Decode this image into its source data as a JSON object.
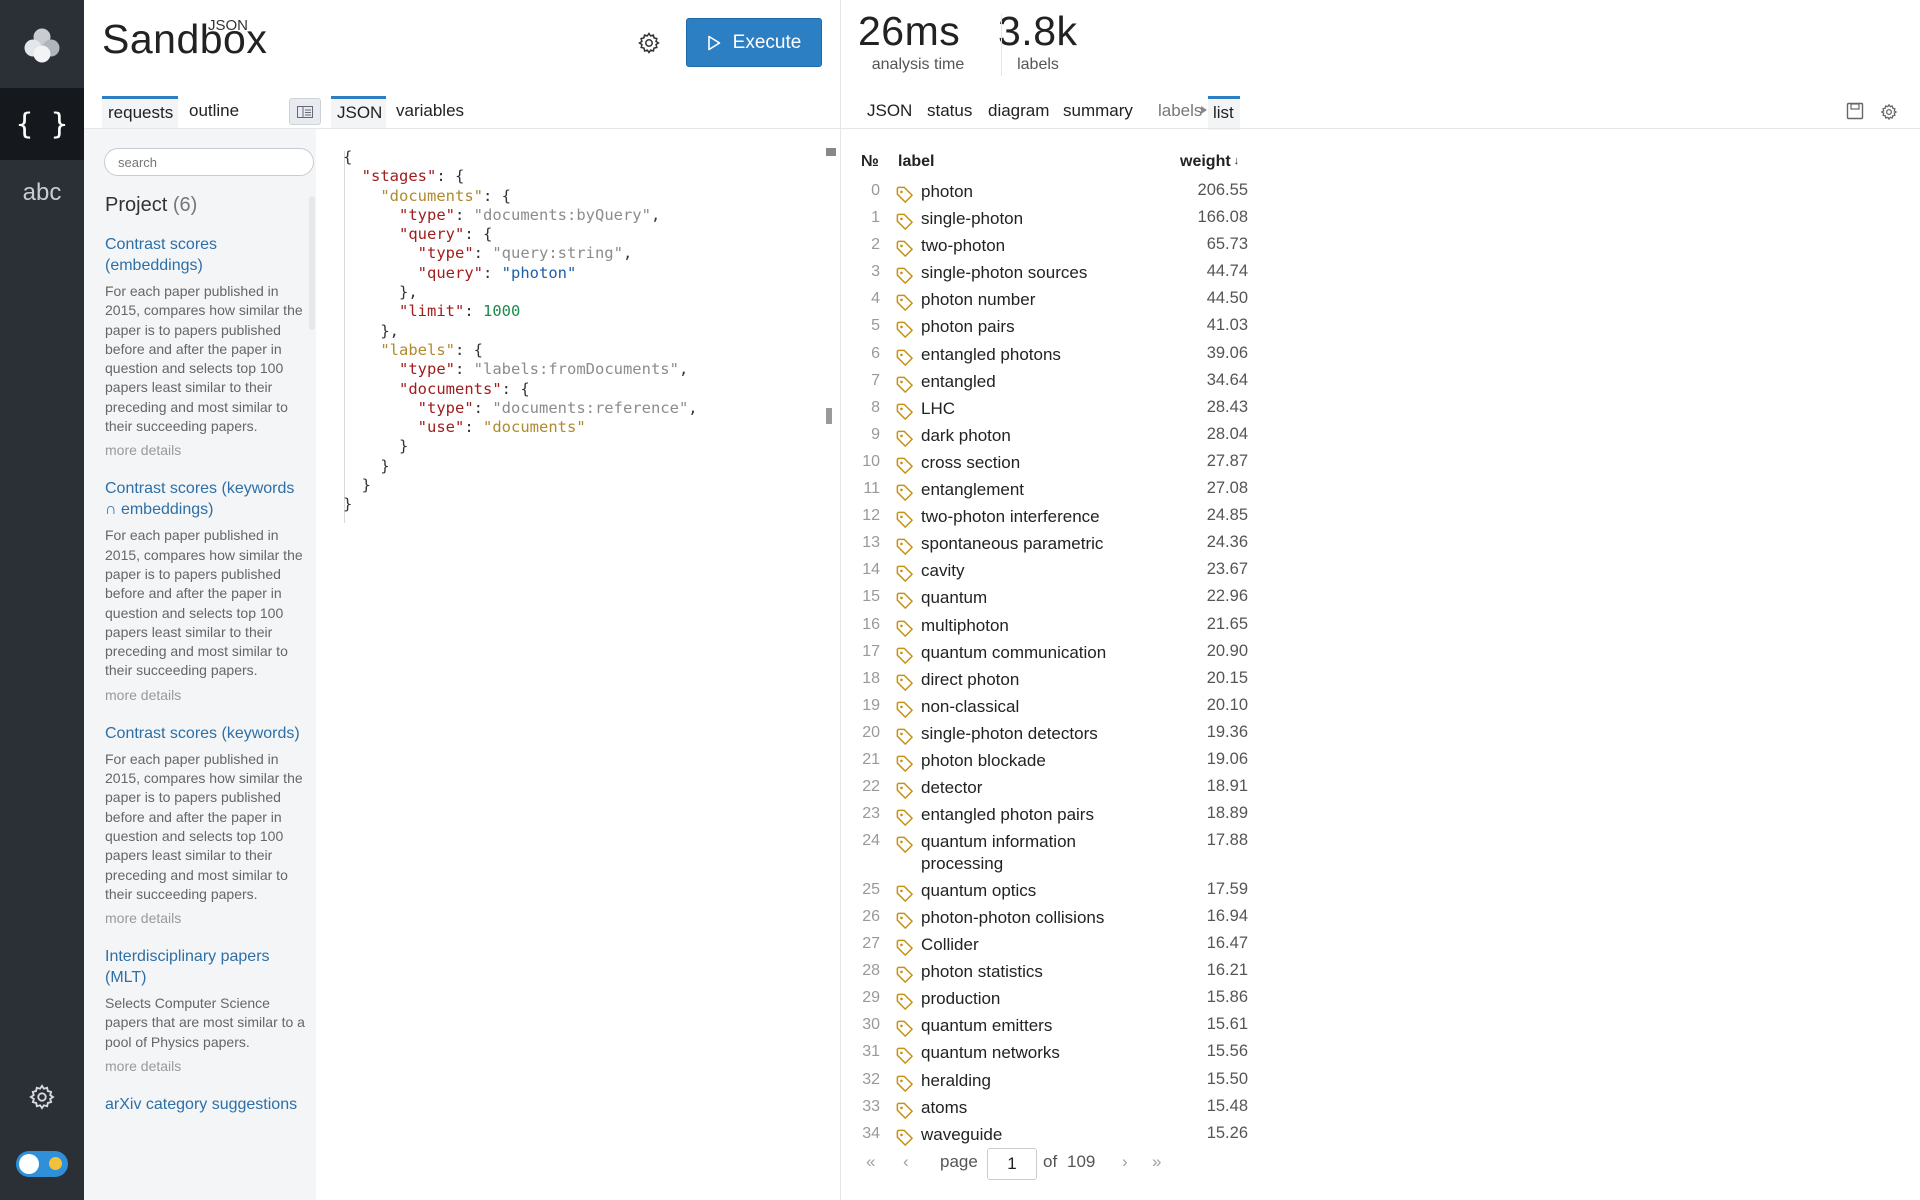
{
  "app": {
    "brand_sup": "JSON",
    "brand": "Sandbox",
    "execute_label": "Execute",
    "rail_json": "{ }",
    "rail_abc": "abc"
  },
  "left_tabs": [
    "requests",
    "outline"
  ],
  "editor_tabs": [
    "JSON",
    "variables"
  ],
  "search": {
    "placeholder": "search"
  },
  "project": {
    "label": "Project",
    "count": "(6)"
  },
  "requests": [
    {
      "title": "Contrast scores (embeddings)",
      "desc": "For each paper published in 2015, compares how similar the paper is to papers published before and after the paper in question and selects top 100 papers least similar to their preceding and most similar to their succeeding papers.",
      "more": "more details"
    },
    {
      "title": "Contrast scores (keywords ∩ embeddings)",
      "desc": "For each paper published in 2015, compares how similar the paper is to papers published before and after the paper in question and selects top 100 papers least similar to their preceding and most similar to their succeeding papers.",
      "more": "more details"
    },
    {
      "title": "Contrast scores (keywords)",
      "desc": "For each paper published in 2015, compares how similar the paper is to papers published before and after the paper in question and selects top 100 papers least similar to their preceding and most similar to their succeeding papers.",
      "more": "more details"
    },
    {
      "title": "Interdisciplinary papers (MLT)",
      "desc": "Selects Computer Science papers that are most similar to a pool of Physics papers.",
      "more": "more details"
    },
    {
      "title": "arXiv category suggestions",
      "desc": "",
      "more": ""
    }
  ],
  "stats": [
    {
      "value": "26ms",
      "label": "analysis time"
    },
    {
      "value": "3.8k",
      "label": "labels"
    }
  ],
  "result_tabs": [
    "JSON",
    "status",
    "diagram",
    "summary",
    "labels",
    "list"
  ],
  "table": {
    "headers": {
      "no": "№",
      "label": "label",
      "weight": "weight"
    },
    "rows": [
      {
        "no": "0",
        "label": "photon",
        "weight": "206.55"
      },
      {
        "no": "1",
        "label": "single-photon",
        "weight": "166.08"
      },
      {
        "no": "2",
        "label": "two-photon",
        "weight": "65.73"
      },
      {
        "no": "3",
        "label": "single-photon sources",
        "weight": "44.74"
      },
      {
        "no": "4",
        "label": "photon number",
        "weight": "44.50"
      },
      {
        "no": "5",
        "label": "photon pairs",
        "weight": "41.03"
      },
      {
        "no": "6",
        "label": "entangled photons",
        "weight": "39.06"
      },
      {
        "no": "7",
        "label": "entangled",
        "weight": "34.64"
      },
      {
        "no": "8",
        "label": "LHC",
        "weight": "28.43"
      },
      {
        "no": "9",
        "label": "dark photon",
        "weight": "28.04"
      },
      {
        "no": "10",
        "label": "cross section",
        "weight": "27.87"
      },
      {
        "no": "11",
        "label": "entanglement",
        "weight": "27.08"
      },
      {
        "no": "12",
        "label": "two-photon interference",
        "weight": "24.85"
      },
      {
        "no": "13",
        "label": "spontaneous parametric",
        "weight": "24.36"
      },
      {
        "no": "14",
        "label": "cavity",
        "weight": "23.67"
      },
      {
        "no": "15",
        "label": "quantum",
        "weight": "22.96"
      },
      {
        "no": "16",
        "label": "multiphoton",
        "weight": "21.65"
      },
      {
        "no": "17",
        "label": "quantum communication",
        "weight": "20.90"
      },
      {
        "no": "18",
        "label": "direct photon",
        "weight": "20.15"
      },
      {
        "no": "19",
        "label": "non-classical",
        "weight": "20.10"
      },
      {
        "no": "20",
        "label": "single-photon detectors",
        "weight": "19.36"
      },
      {
        "no": "21",
        "label": "photon blockade",
        "weight": "19.06"
      },
      {
        "no": "22",
        "label": "detector",
        "weight": "18.91"
      },
      {
        "no": "23",
        "label": "entangled photon pairs",
        "weight": "18.89"
      },
      {
        "no": "24",
        "label": "quantum information processing",
        "weight": "17.88"
      },
      {
        "no": "25",
        "label": "quantum optics",
        "weight": "17.59"
      },
      {
        "no": "26",
        "label": "photon-photon collisions",
        "weight": "16.94"
      },
      {
        "no": "27",
        "label": "Collider",
        "weight": "16.47"
      },
      {
        "no": "28",
        "label": "photon statistics",
        "weight": "16.21"
      },
      {
        "no": "29",
        "label": "production",
        "weight": "15.86"
      },
      {
        "no": "30",
        "label": "quantum emitters",
        "weight": "15.61"
      },
      {
        "no": "31",
        "label": "quantum networks",
        "weight": "15.56"
      },
      {
        "no": "32",
        "label": "heralding",
        "weight": "15.50"
      },
      {
        "no": "33",
        "label": "atoms",
        "weight": "15.48"
      },
      {
        "no": "34",
        "label": "waveguide",
        "weight": "15.26"
      }
    ]
  },
  "pager": {
    "page_label": "page",
    "page": "1",
    "of_label": "of",
    "total": "109"
  },
  "colors": {
    "accent": "#2d7fc3",
    "rail": "#2b2f36",
    "tag": "#c69214",
    "link": "#2d6fa6"
  },
  "icons": [
    "logo-icon",
    "braces-icon",
    "abc-icon",
    "gear-icon",
    "theme-toggle",
    "play-icon",
    "panel-toggle-icon",
    "tag-icon",
    "save-icon",
    "first-page-icon",
    "prev-page-icon",
    "next-page-icon",
    "last-page-icon"
  ]
}
